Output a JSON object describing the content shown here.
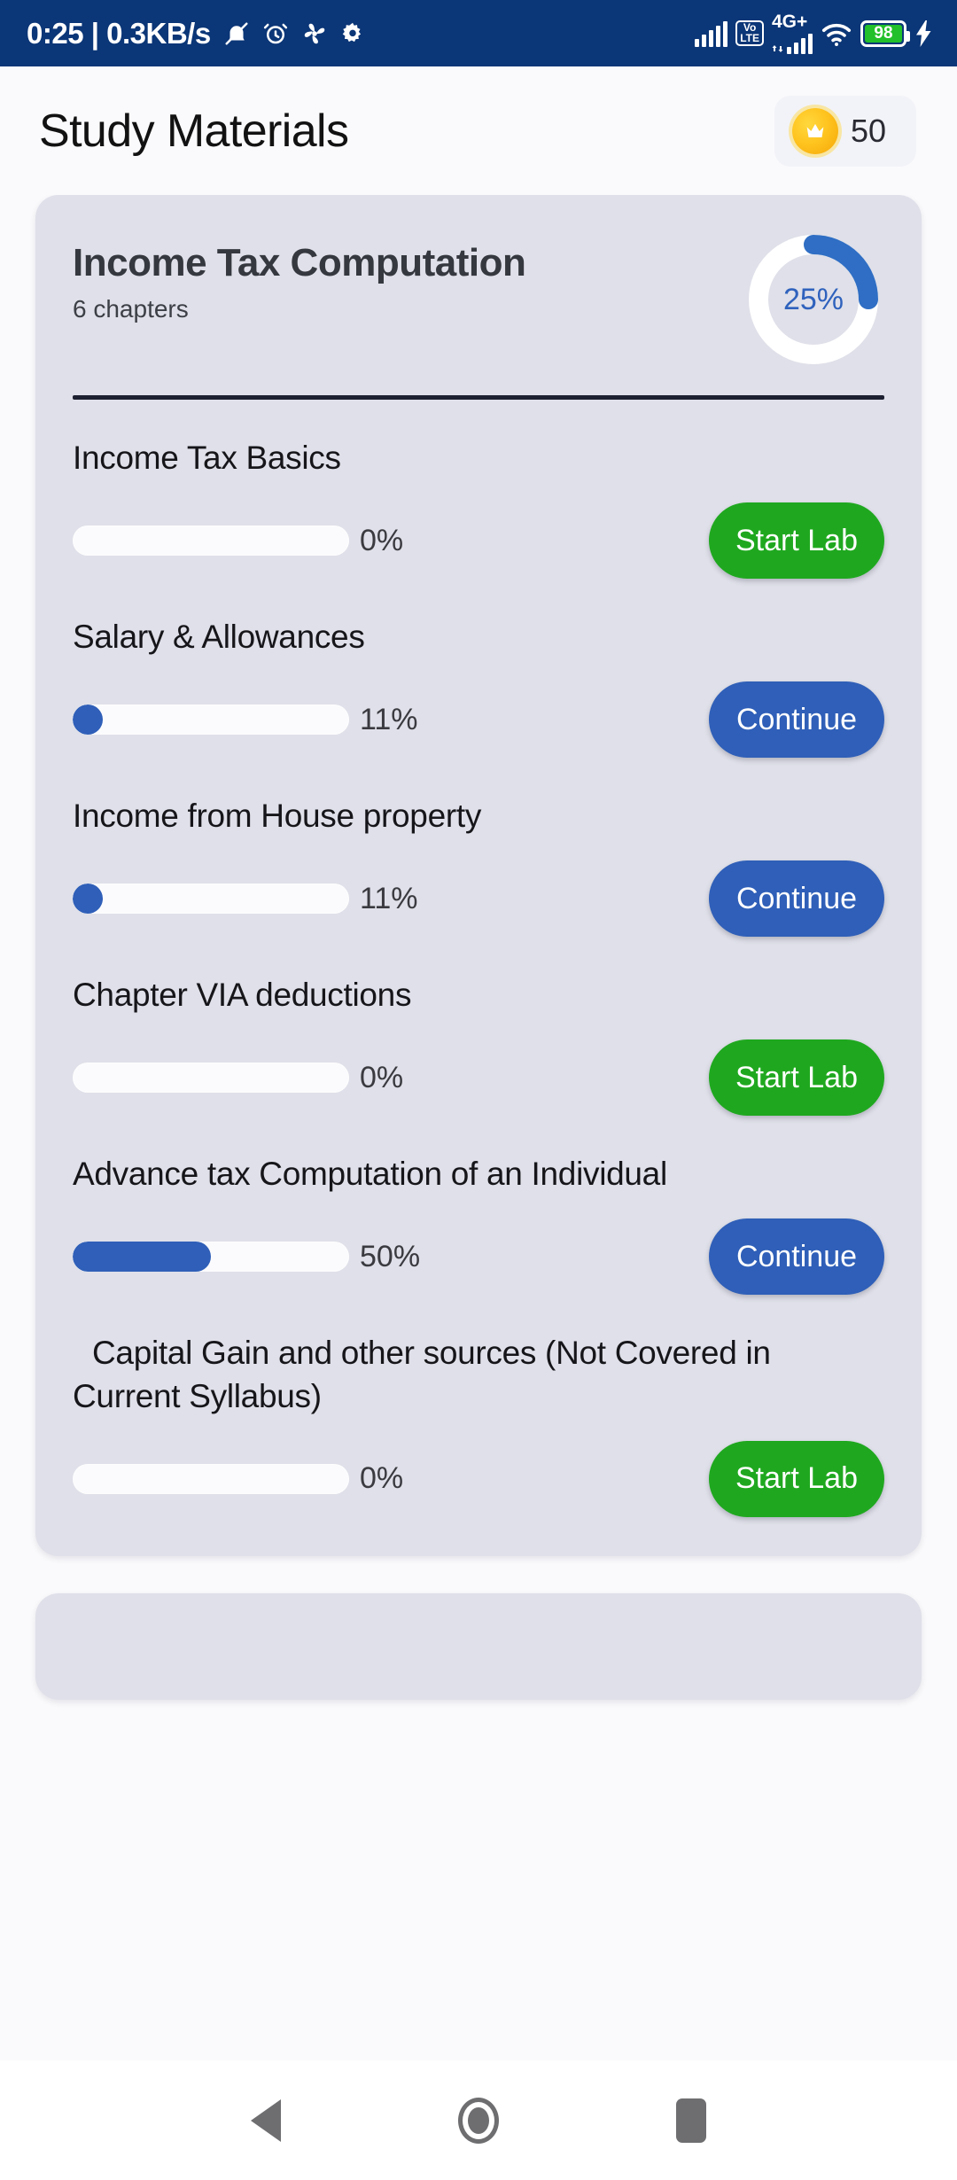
{
  "status_bar": {
    "clock": "0:25",
    "separator": "|",
    "network_speed": "0.3KB/s",
    "left_icons": [
      "mute-bell-icon",
      "alarm-clock-icon",
      "fan-icon",
      "gear-icon"
    ],
    "signal_bars_count": 5,
    "volte_top": "Vo",
    "volte_bottom": "LTE",
    "network_type": "4G+",
    "wifi_icon": "wifi-icon",
    "battery_percent": "98",
    "charging_icon": "lightning-bolt-icon",
    "background_color": "#0b3677"
  },
  "header": {
    "title": "Study Materials",
    "coin_icon": "crown-coin-icon",
    "coin_count": "50"
  },
  "course": {
    "title": "Income Tax Computation",
    "chapters_label": "6 chapters",
    "progress_percent": 25,
    "progress_label": "25%",
    "ring_track_color": "#ffffff",
    "ring_fill_color": "#2f6ec4"
  },
  "colors": {
    "card_background": "#dfe0e9",
    "page_background": "#fafafc",
    "accent_blue": "#2f5fb8",
    "accent_green": "#1fa81f",
    "divider": "#1d2030"
  },
  "chapters": [
    {
      "title": "Income Tax Basics",
      "progress": 0,
      "progress_label": "0%",
      "cta_label": "Start Lab",
      "cta_style": "green"
    },
    {
      "title": "Salary & Allowances",
      "progress": 11,
      "progress_label": "11%",
      "cta_label": "Continue",
      "cta_style": "blue"
    },
    {
      "title": "Income from House property",
      "progress": 11,
      "progress_label": "11%",
      "cta_label": "Continue",
      "cta_style": "blue"
    },
    {
      "title": "Chapter VIA deductions",
      "progress": 0,
      "progress_label": "0%",
      "cta_label": "Start Lab",
      "cta_style": "green"
    },
    {
      "title": "Advance tax Computation of an Individual",
      "progress": 50,
      "progress_label": "50%",
      "cta_label": "Continue",
      "cta_style": "blue"
    },
    {
      "title": "Capital Gain and other sources (Not Covered in Current Syllabus)",
      "progress": 0,
      "progress_label": "0%",
      "cta_label": "Start Lab",
      "cta_style": "green",
      "indent": true
    }
  ],
  "navbar": {
    "back": "back-triangle-icon",
    "home": "home-circle-icon",
    "recents": "recents-square-icon"
  }
}
